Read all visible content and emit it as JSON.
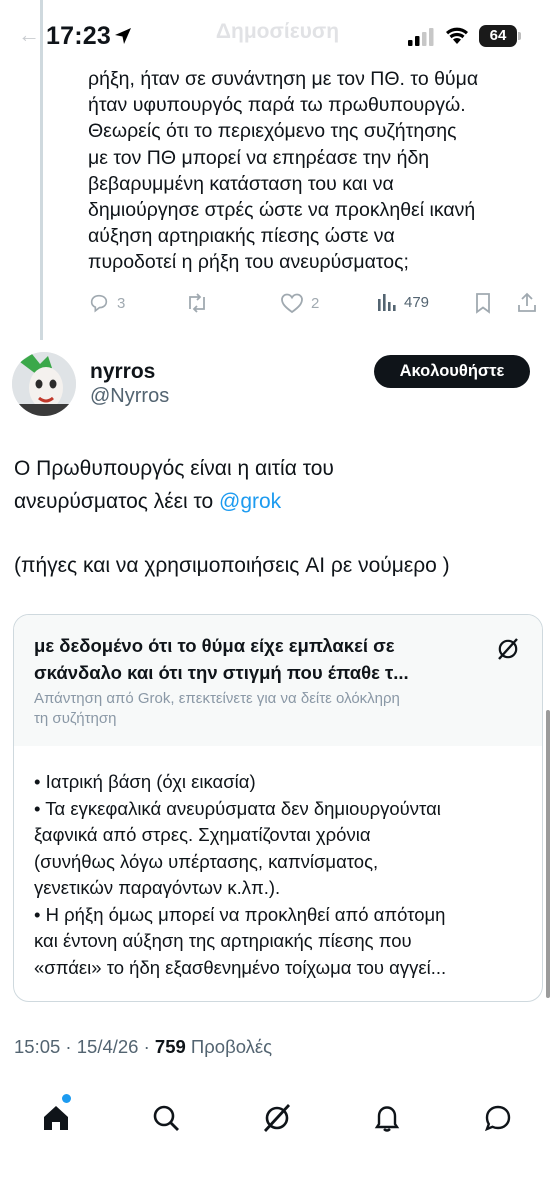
{
  "status_bar": {
    "time": "17:23",
    "battery": "64"
  },
  "header": {
    "title": "Δημοσίευση"
  },
  "previous_reply": {
    "lines": [
      "ρήξη, ήταν σε συνάντηση με τον ΠΘ.  το θύμα",
      "ήταν υφυπουργός παρά τω πρωθυπουργώ.",
      "Θεωρείς ότι το περιεχόμενο της συζήτησης",
      "με τον ΠΘ  μπορεί να  επηρέασε την ήδη",
      "βεβαρυμμένη κατάσταση του και να",
      "δημιούργησε στρές ώστε να προκληθεί ικανή",
      "αύξηση αρτηριακής πίεσης ώστε να",
      "πυροδοτεί η ρήξη του ανευρύσματος;"
    ],
    "replies": "3",
    "likes": "2",
    "views": "479"
  },
  "author": {
    "name": "nyrros",
    "handle": "@Nyrros",
    "follow_label": "Ακολουθήστε"
  },
  "tweet": {
    "line1": "Ο Πρωθυπουργός είναι η αιτία του",
    "line2_prefix": "ανευρύσματος λέει το ",
    "mention": "@grok",
    "line3": "(πήγες  και να χρησιμοποιήσεις AI ρε νούμερο )"
  },
  "grok_card": {
    "question_line1": "με δεδομένο ότι το θύμα είχε εμπλακεί σε",
    "question_line2": "σκάνδαλο και ότι την στιγμή που έπαθε τ...",
    "sub_line1": "Απάντηση από Grok, επεκτείνετε για να δείτε ολόκληρη",
    "sub_line2": "τη συζήτηση",
    "body": [
      "• Ιατρική βάση (όχι εικασία)",
      "• Τα εγκεφαλικά ανευρύσματα δεν δημιουργούνται",
      "ξαφνικά από στρες. Σχηματίζονται χρόνια",
      "(συνήθως λόγω υπέρτασης, καπνίσματος,",
      "γενετικών παραγόντων κ.λπ.).",
      "• Η ρήξη όμως μπορεί να προκληθεί από απότομη",
      "και έντονη αύξηση της αρτηριακής πίεσης που",
      "«σπάει» το ήδη εξασθενημένο τοίχωμα του αγγεί..."
    ]
  },
  "meta": {
    "timestamp": "15:05 · 15/4/26 · ",
    "views_count": "759",
    "views_label": " Προβολές"
  },
  "colors": {
    "accent": "#1d9bf0",
    "text": "#0f1419",
    "muted": "#536471"
  },
  "nav": [
    "home-icon",
    "search-icon",
    "grok-icon",
    "notifications-icon",
    "messages-icon"
  ]
}
